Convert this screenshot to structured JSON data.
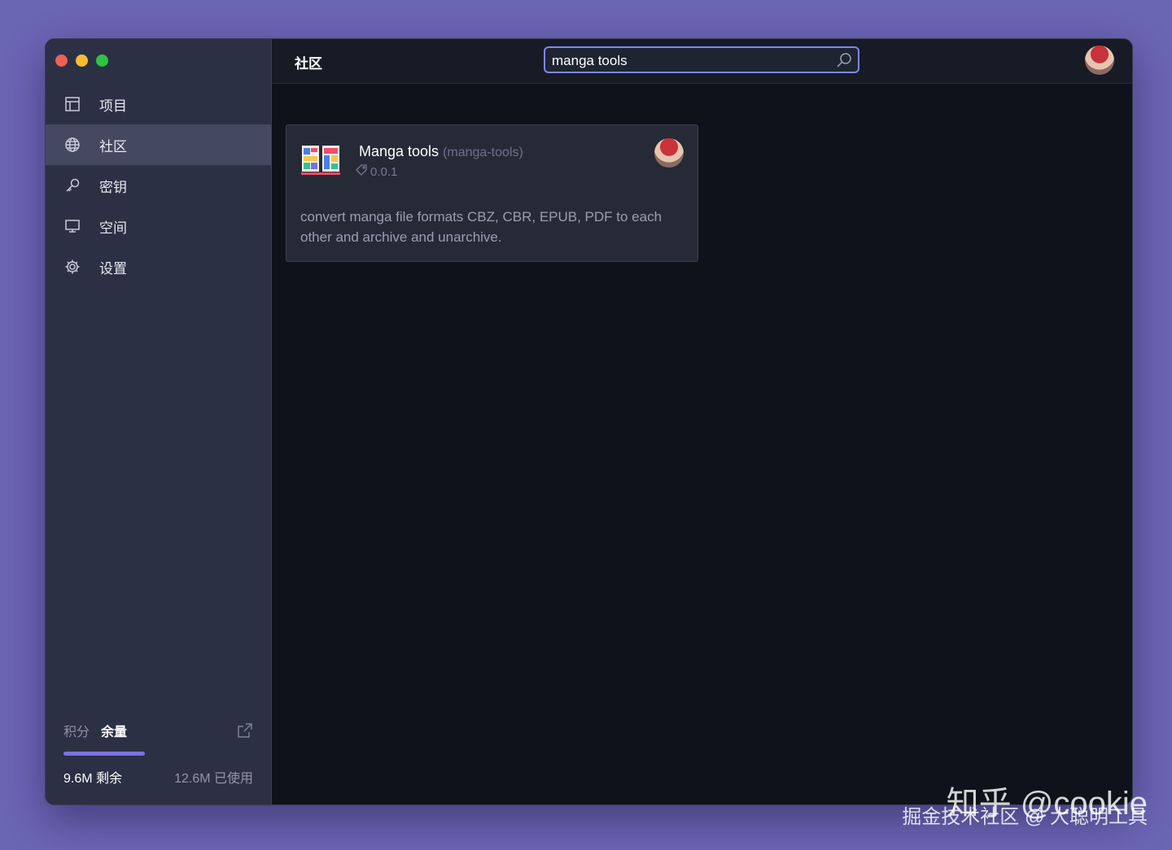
{
  "window": {
    "traffic_lights": [
      "#ee5f57",
      "#f4bd2f",
      "#2ac640"
    ]
  },
  "sidebar": {
    "items": [
      {
        "label": "项目",
        "icon": "table-icon"
      },
      {
        "label": "社区",
        "icon": "globe-icon",
        "active": true
      },
      {
        "label": "密钥",
        "icon": "key-icon"
      },
      {
        "label": "空间",
        "icon": "monitor-icon"
      },
      {
        "label": "设置",
        "icon": "gear-icon"
      }
    ],
    "quota": {
      "tab_points": "积分",
      "tab_remaining": "余量",
      "remaining": "9.6M 剩余",
      "used": "12.6M 已使用",
      "remaining_fraction": 0.43,
      "bar_color": "#7b73e0"
    }
  },
  "header": {
    "title": "社区",
    "search": {
      "value": "manga tools"
    }
  },
  "results": [
    {
      "name": "Manga tools",
      "slug": "(manga-tools)",
      "version": "0.0.1",
      "description": "convert manga file formats CBZ, CBR, EPUB, PDF to each other and archive and unarchive."
    }
  ],
  "watermark": {
    "line1": "知乎 @cookie",
    "line2": "掘金技术社区 @ 大聪明工具"
  }
}
